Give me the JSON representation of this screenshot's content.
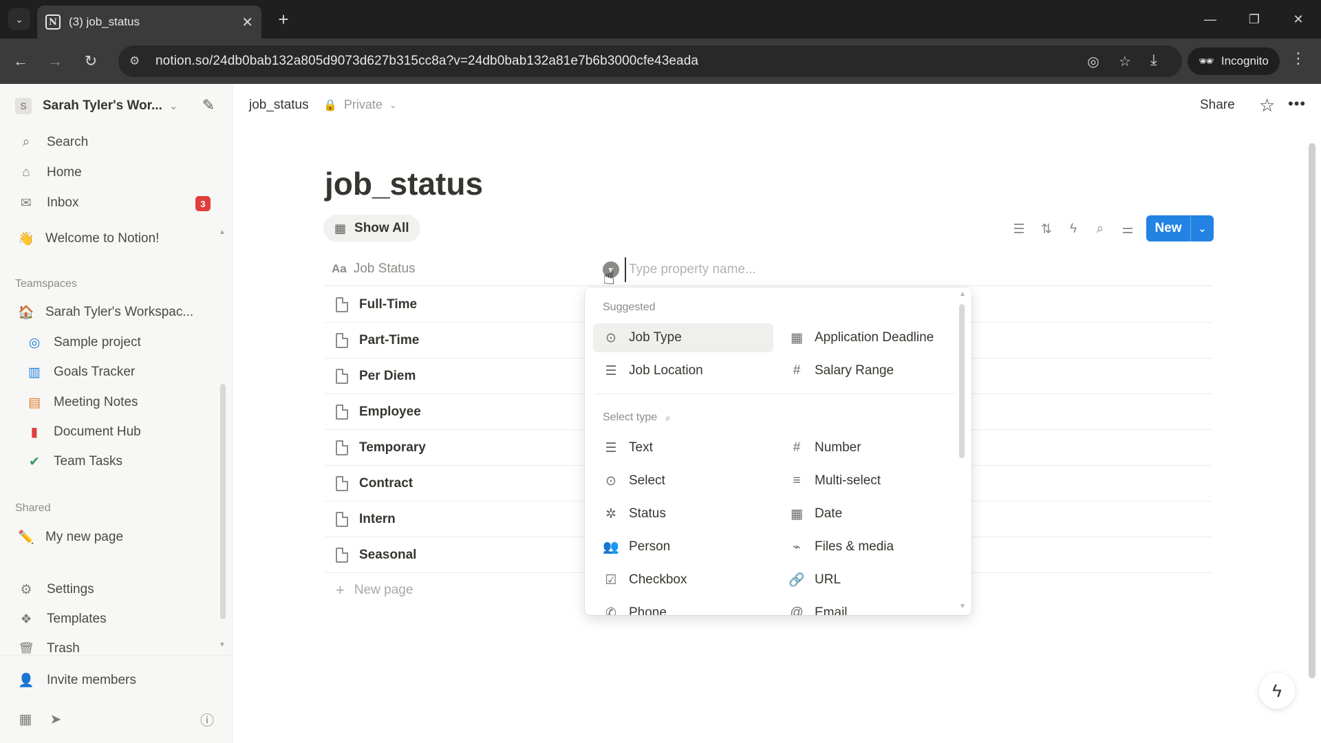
{
  "browser": {
    "tab_title": "(3) job_status",
    "favicon": "N",
    "url": "notion.so/24db0bab132a805d9073d627b315cc8a?v=24db0bab132a81e7b6b3000cfe43eada",
    "incognito_label": "Incognito"
  },
  "sidebar": {
    "workspace_initial": "S",
    "workspace_name": "Sarah Tyler's Wor...",
    "nav": [
      {
        "label": "Search"
      },
      {
        "label": "Home"
      },
      {
        "label": "Inbox",
        "badge": "3"
      }
    ],
    "welcome": {
      "icon": "👋",
      "label": "Welcome to Notion!"
    },
    "teamspaces_title": "Teamspaces",
    "teamspace": {
      "icon": "🏠",
      "label": "Sarah Tyler's Workspac..."
    },
    "teamspace_pages": [
      {
        "label": "Sample project",
        "icon": "sample-project-icon"
      },
      {
        "label": "Goals Tracker",
        "icon": "goals-tracker-icon"
      },
      {
        "label": "Meeting Notes",
        "icon": "meeting-notes-icon"
      },
      {
        "label": "Document Hub",
        "icon": "document-hub-icon"
      },
      {
        "label": "Team Tasks",
        "icon": "team-tasks-icon"
      }
    ],
    "shared_title": "Shared",
    "shared_pages": [
      {
        "label": "My new page",
        "icon": "✏️"
      }
    ],
    "bottom": [
      {
        "label": "Settings"
      },
      {
        "label": "Templates"
      },
      {
        "label": "Trash"
      }
    ],
    "invite_label": "Invite members"
  },
  "topbar": {
    "breadcrumb": "job_status",
    "privacy": "Private",
    "share": "Share"
  },
  "page": {
    "title": "job_status",
    "view_tab": "Show All",
    "new_button": "New",
    "column_header": "Job Status",
    "rows": [
      "Full-Time",
      "Part-Time",
      "Per Diem",
      "Employee",
      "Temporary",
      "Contract",
      "Intern",
      "Seasonal"
    ],
    "new_page_label": "New page",
    "property_placeholder": "Type property name..."
  },
  "popup": {
    "suggested_title": "Suggested",
    "suggested": [
      {
        "label": "Job Type",
        "icon": "select-icon"
      },
      {
        "label": "Application Deadline",
        "icon": "calendar-icon"
      },
      {
        "label": "Job Location",
        "icon": "text-icon"
      },
      {
        "label": "Salary Range",
        "icon": "hash-icon"
      }
    ],
    "select_type_title": "Select type",
    "types": [
      {
        "label": "Text",
        "icon": "text-icon"
      },
      {
        "label": "Number",
        "icon": "hash-icon"
      },
      {
        "label": "Select",
        "icon": "select-icon"
      },
      {
        "label": "Multi-select",
        "icon": "list-icon"
      },
      {
        "label": "Status",
        "icon": "status-icon"
      },
      {
        "label": "Date",
        "icon": "calendar-icon"
      },
      {
        "label": "Person",
        "icon": "person-icon"
      },
      {
        "label": "Files & media",
        "icon": "paperclip-icon"
      },
      {
        "label": "Checkbox",
        "icon": "checkbox-icon"
      },
      {
        "label": "URL",
        "icon": "link-icon"
      },
      {
        "label": "Phone",
        "icon": "phone-icon"
      },
      {
        "label": "Email",
        "icon": "email-icon"
      }
    ]
  },
  "colors": {
    "accent": "#2383e2",
    "badge": "#e03e3e",
    "sidebar_bg": "#f7f7f5"
  }
}
